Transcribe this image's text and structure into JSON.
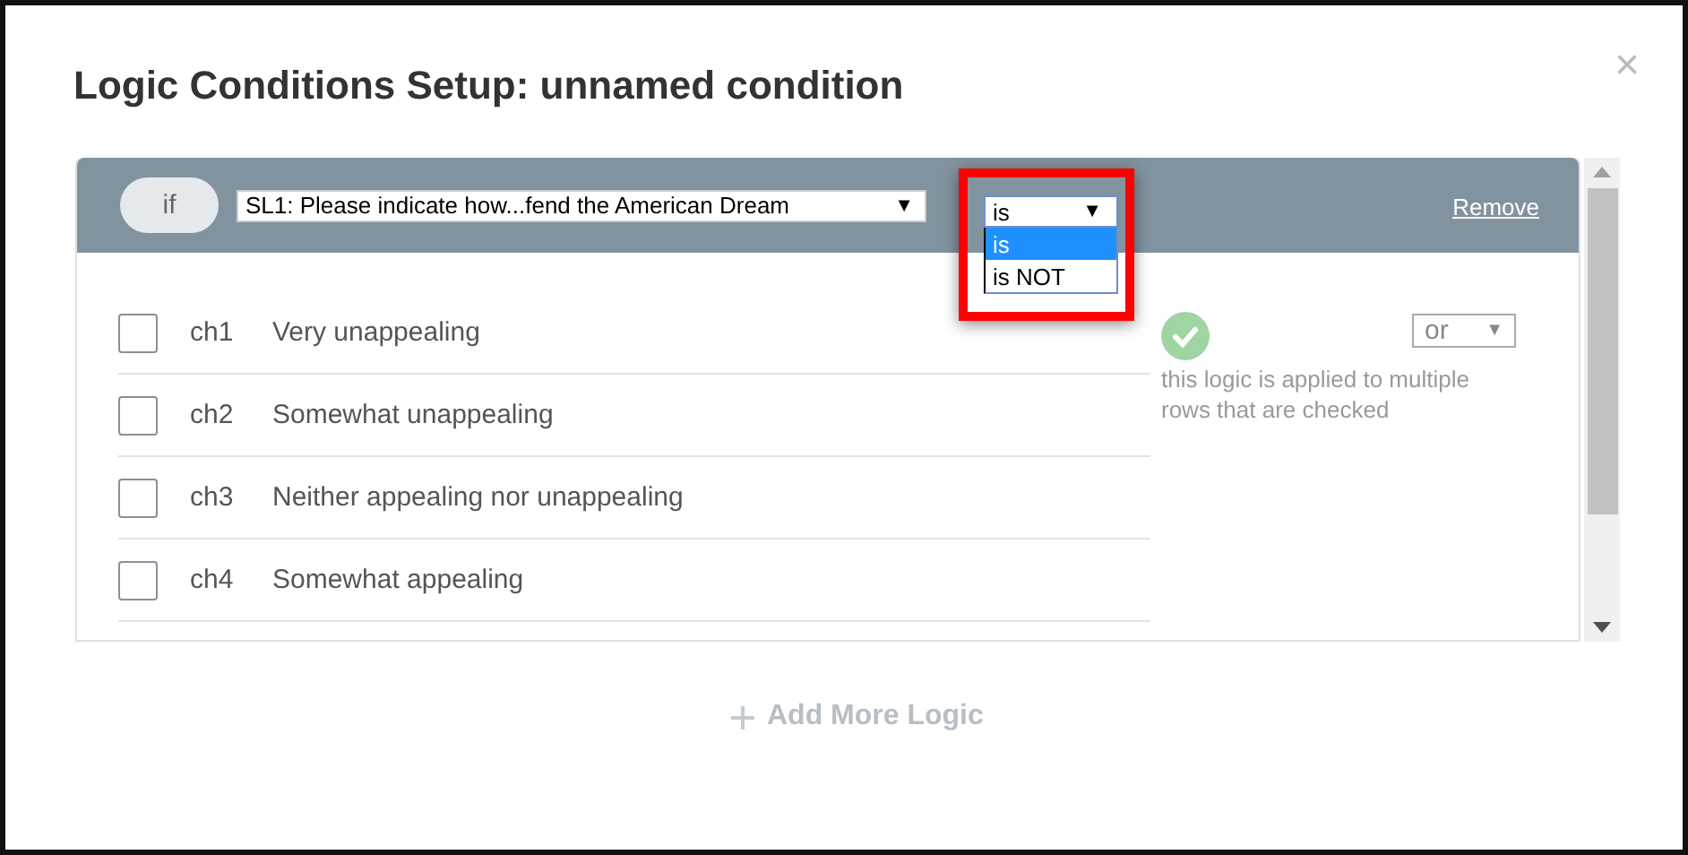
{
  "dialog": {
    "title": "Logic Conditions Setup: unnamed condition",
    "close": "×"
  },
  "condition": {
    "keyword": "if",
    "question": "SL1: Please indicate how...fend the American Dream",
    "question_arrow": "▼",
    "operator": "is",
    "operator_arrow": "▼",
    "operator_options": [
      {
        "label": "is",
        "selected": true
      },
      {
        "label": "is NOT",
        "selected": false
      }
    ],
    "remove": "Remove",
    "choices": [
      {
        "code": "ch1",
        "label": "Very unappealing",
        "checked": false
      },
      {
        "code": "ch2",
        "label": "Somewhat unappealing",
        "checked": false
      },
      {
        "code": "ch3",
        "label": "Neither appealing nor unappealing",
        "checked": false
      },
      {
        "code": "ch4",
        "label": "Somewhat appealing",
        "checked": false
      }
    ],
    "combiner": {
      "value": "or",
      "arrow": "▼"
    },
    "note": "this logic is applied to multiple rows that are checked"
  },
  "add_more": {
    "label": "Add More Logic"
  }
}
